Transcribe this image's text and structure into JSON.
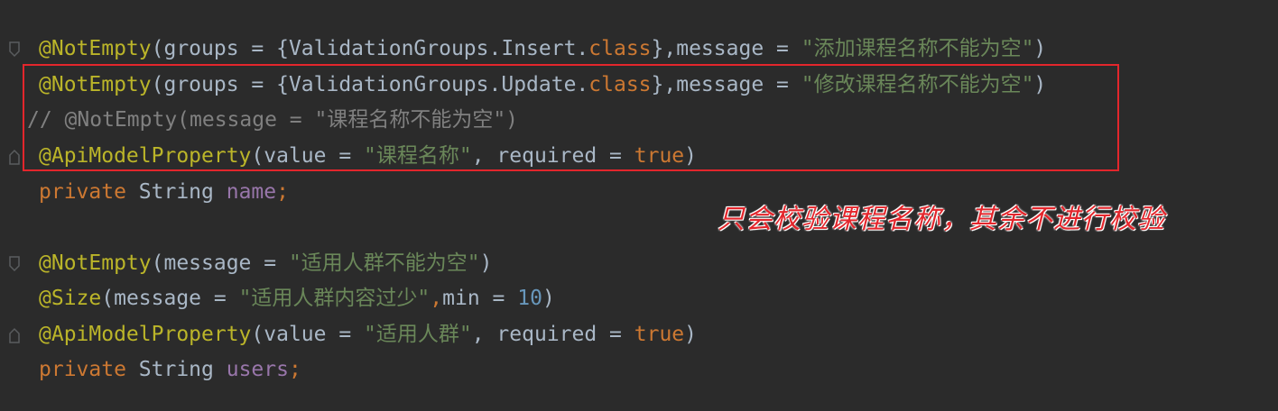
{
  "editor": {
    "lines": [
      {
        "tokens": [
          {
            "t": "@NotEmpty",
            "c": "anno"
          },
          {
            "t": "(groups = {ValidationGroups.Insert.",
            "c": "plain"
          },
          {
            "t": "class",
            "c": "kw"
          },
          {
            "t": "},",
            "c": "plain"
          },
          {
            "t": "message = ",
            "c": "plain"
          },
          {
            "t": "\"添加课程名称不能为空\"",
            "c": "str"
          },
          {
            "t": ")",
            "c": "plain"
          }
        ]
      },
      {
        "tokens": [
          {
            "t": "@NotEmpty",
            "c": "anno"
          },
          {
            "t": "(groups = {ValidationGroups.Update.",
            "c": "plain"
          },
          {
            "t": "class",
            "c": "kw"
          },
          {
            "t": "},",
            "c": "plain"
          },
          {
            "t": "message = ",
            "c": "plain"
          },
          {
            "t": "\"修改课程名称不能为空\"",
            "c": "str"
          },
          {
            "t": ")",
            "c": "plain"
          }
        ]
      },
      {
        "tokens": [
          {
            "t": "// @NotEmpty(message = \"课程名称不能为空\")",
            "c": "cmt"
          }
        ]
      },
      {
        "tokens": [
          {
            "t": "@ApiModelProperty",
            "c": "anno"
          },
          {
            "t": "(value = ",
            "c": "plain"
          },
          {
            "t": "\"课程名称\"",
            "c": "str"
          },
          {
            "t": ", required = ",
            "c": "plain"
          },
          {
            "t": "true",
            "c": "kw"
          },
          {
            "t": ")",
            "c": "plain"
          }
        ]
      },
      {
        "tokens": [
          {
            "t": "private ",
            "c": "kw"
          },
          {
            "t": "String ",
            "c": "plain"
          },
          {
            "t": "name",
            "c": "field"
          },
          {
            "t": ";",
            "c": "kw"
          }
        ]
      },
      {
        "tokens": []
      },
      {
        "tokens": [
          {
            "t": "@NotEmpty",
            "c": "anno"
          },
          {
            "t": "(message = ",
            "c": "plain"
          },
          {
            "t": "\"适用人群不能为空\"",
            "c": "str"
          },
          {
            "t": ")",
            "c": "plain"
          }
        ]
      },
      {
        "tokens": [
          {
            "t": "@Size",
            "c": "anno"
          },
          {
            "t": "(message = ",
            "c": "plain"
          },
          {
            "t": "\"适用人群内容过少\"",
            "c": "str"
          },
          {
            "t": ",",
            "c": "kw"
          },
          {
            "t": "min = ",
            "c": "plain"
          },
          {
            "t": "10",
            "c": "num"
          },
          {
            "t": ")",
            "c": "plain"
          }
        ]
      },
      {
        "tokens": [
          {
            "t": "@ApiModelProperty",
            "c": "anno"
          },
          {
            "t": "(value = ",
            "c": "plain"
          },
          {
            "t": "\"适用人群\"",
            "c": "str"
          },
          {
            "t": ", required = ",
            "c": "plain"
          },
          {
            "t": "true",
            "c": "kw"
          },
          {
            "t": ")",
            "c": "plain"
          }
        ]
      },
      {
        "tokens": [
          {
            "t": "private ",
            "c": "kw"
          },
          {
            "t": "String ",
            "c": "plain"
          },
          {
            "t": "users",
            "c": "field"
          },
          {
            "t": ";",
            "c": "kw"
          }
        ]
      }
    ]
  },
  "annotation": {
    "note": "只会校验课程名称，其余不进行校验",
    "box_color": "#e3262c"
  },
  "colors": {
    "background": "#2b2b2b",
    "annotation": "#bbb529",
    "keyword": "#cc7832",
    "string": "#6a8759",
    "number": "#6897bb",
    "field": "#9876aa",
    "comment": "#808080",
    "plain": "#a9b7c6"
  }
}
